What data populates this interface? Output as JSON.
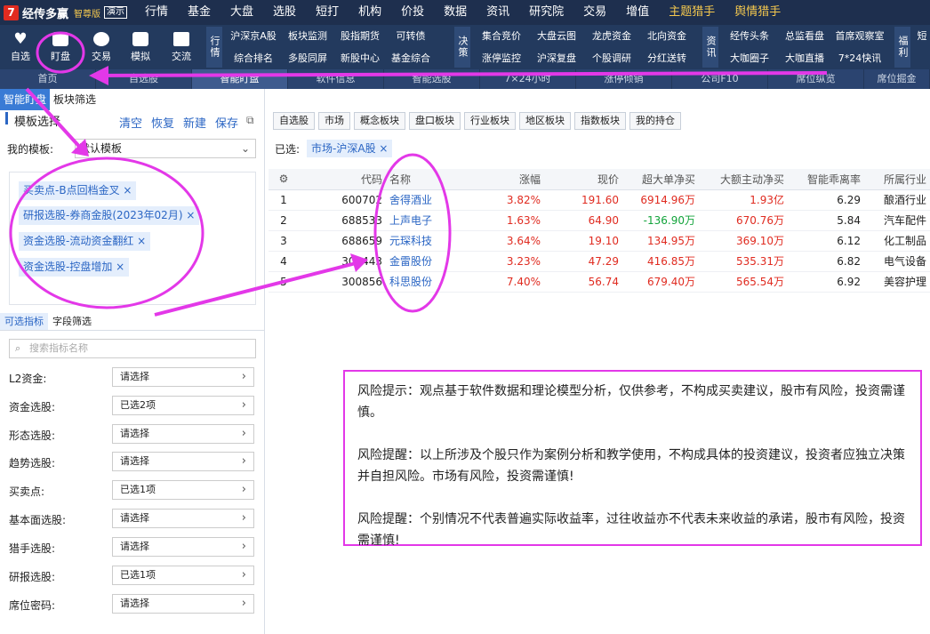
{
  "app": {
    "logo_text": "经传多赢",
    "edition": "智尊版",
    "demo": "演示"
  },
  "menu": [
    "行情",
    "基金",
    "大盘",
    "选股",
    "短打",
    "机构",
    "价投",
    "数据",
    "资讯",
    "研究院",
    "交易",
    "增值",
    "主题猎手",
    "舆情猎手"
  ],
  "toolbar": {
    "items": [
      {
        "label": "自选",
        "icon": "heart-icon"
      },
      {
        "label": "盯盘",
        "icon": "chart-icon"
      },
      {
        "label": "交易",
        "icon": "coin-icon"
      },
      {
        "label": "模拟",
        "icon": "gamepad-icon"
      },
      {
        "label": "交流",
        "icon": "chat-icon"
      }
    ],
    "groups": [
      {
        "tag": "行情",
        "items": [
          "沪深京A股",
          "综合排名",
          "板块监测",
          "多股同屏",
          "股指期货",
          "新股中心",
          "可转债",
          "基金综合"
        ]
      },
      {
        "tag": "决策",
        "items": [
          "集合竞价",
          "涨停监控",
          "大盘云图",
          "沪深复盘",
          "龙虎资金",
          "个股调研",
          "北向资金",
          "分红送转"
        ]
      },
      {
        "tag": "资讯",
        "items": [
          "经传头条",
          "大咖圈子",
          "总监看盘",
          "大咖直播",
          "首席观察室",
          "7*24快讯"
        ]
      },
      {
        "tag": "福利",
        "items": [
          "短"
        ]
      }
    ]
  },
  "tabs": [
    "首页",
    "自选股",
    "智能盯盘",
    "软件信息",
    "智能选股",
    "7×24小时",
    "涨停倾销",
    "公司F10",
    "席位纵览",
    "席位掘金"
  ],
  "left": {
    "tabs": [
      "智能盯盘",
      "板块筛选"
    ],
    "section_title": "模板选择",
    "actions": [
      "清空",
      "恢复",
      "新建",
      "保存"
    ],
    "template_label": "我的模板:",
    "template_value": "默认模板",
    "chips": [
      "买卖点-B点回档金叉",
      "研报选股-券商金股(2023年02月)",
      "资金选股-流动资金翻红",
      "资金选股-控盘增加"
    ],
    "subtabs": [
      "可选指标",
      "字段筛选"
    ],
    "search_placeholder": "搜索指标名称",
    "filters": [
      {
        "label": "L2资金:",
        "value": "请选择"
      },
      {
        "label": "资金选股:",
        "value": "已选2项"
      },
      {
        "label": "形态选股:",
        "value": "请选择"
      },
      {
        "label": "趋势选股:",
        "value": "请选择"
      },
      {
        "label": "买卖点:",
        "value": "已选1项"
      },
      {
        "label": "基本面选股:",
        "value": "请选择"
      },
      {
        "label": "猎手选股:",
        "value": "请选择"
      },
      {
        "label": "研报选股:",
        "value": "已选1项"
      },
      {
        "label": "席位密码:",
        "value": "请选择"
      }
    ]
  },
  "main": {
    "filter_tabs": [
      "自选股",
      "市场",
      "概念板块",
      "盘口板块",
      "行业板块",
      "地区板块",
      "指数板块",
      "我的持仓"
    ],
    "selected_label": "已选:",
    "selected_chip": "市场-沪深A股",
    "columns": [
      "代码",
      "名称",
      "涨幅",
      "现价",
      "超大单净买",
      "大额主动净买",
      "智能乖离率",
      "所属行业"
    ],
    "rows": [
      {
        "no": "1",
        "code": "600702",
        "name": "舍得酒业",
        "pct": "3.82%",
        "price": "191.60",
        "super": "6914.96万",
        "big": "1.93亿",
        "bias": "6.29",
        "industry": "酿酒行业"
      },
      {
        "no": "2",
        "code": "688533",
        "name": "上声电子",
        "pct": "1.63%",
        "price": "64.90",
        "super": "-136.90万",
        "big": "670.76万",
        "bias": "5.84",
        "industry": "汽车配件"
      },
      {
        "no": "3",
        "code": "688659",
        "name": "元琛科技",
        "pct": "3.64%",
        "price": "19.10",
        "super": "134.95万",
        "big": "369.10万",
        "bias": "6.12",
        "industry": "化工制品"
      },
      {
        "no": "4",
        "code": "300443",
        "name": "金雷股份",
        "pct": "3.23%",
        "price": "47.29",
        "super": "416.85万",
        "big": "535.31万",
        "bias": "6.82",
        "industry": "电气设备"
      },
      {
        "no": "5",
        "code": "300856",
        "name": "科思股份",
        "pct": "7.40%",
        "price": "56.74",
        "super": "679.40万",
        "big": "565.54万",
        "bias": "6.92",
        "industry": "美容护理"
      }
    ]
  },
  "risk": [
    "风险提示：观点基于软件数据和理论模型分析，仅供参考，不构成买卖建议，股市有风险，投资需谨慎。",
    "风险提醒：以上所涉及个股只作为案例分析和教学使用，不构成具体的投资建议，投资者应独立决策并自担风险。市场有风险，投资需谨慎!",
    "风险提醒：个别情况不代表普遍实际收益率，过往收益亦不代表未来收益的承诺，股市有风险，投资需谨慎!"
  ],
  "colors": {
    "topbar": "#1e2f4e",
    "toolbar": "#233a5e",
    "accent": "#2b66c4",
    "up": "#e02b20",
    "down": "#11a33a",
    "annotation": "#e338e8"
  }
}
